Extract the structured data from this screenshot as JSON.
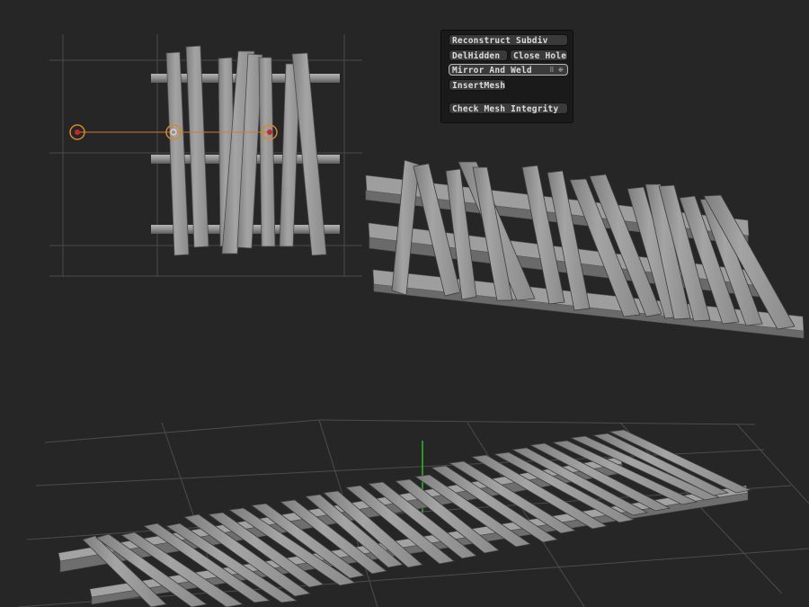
{
  "panel": {
    "buttons": {
      "reconstruct": "Reconstruct Subdiv",
      "delhidden": "DelHidden",
      "close_holes": "Close Holes",
      "mirror_weld": "Mirror And Weld",
      "insert_mesh": "InsertMesh",
      "check_integrity": "Check Mesh Integrity"
    },
    "mirror_icons": "⠿ ⁜"
  },
  "colors": {
    "background": "#262626",
    "plank": "#9a9a9a",
    "grid": "#555555",
    "gizmo_orange": "#e08a2c",
    "gizmo_red": "#c8282a",
    "axis_green": "#2fb82f"
  },
  "viewports": [
    "front-view",
    "perspective-view",
    "floor-view"
  ]
}
